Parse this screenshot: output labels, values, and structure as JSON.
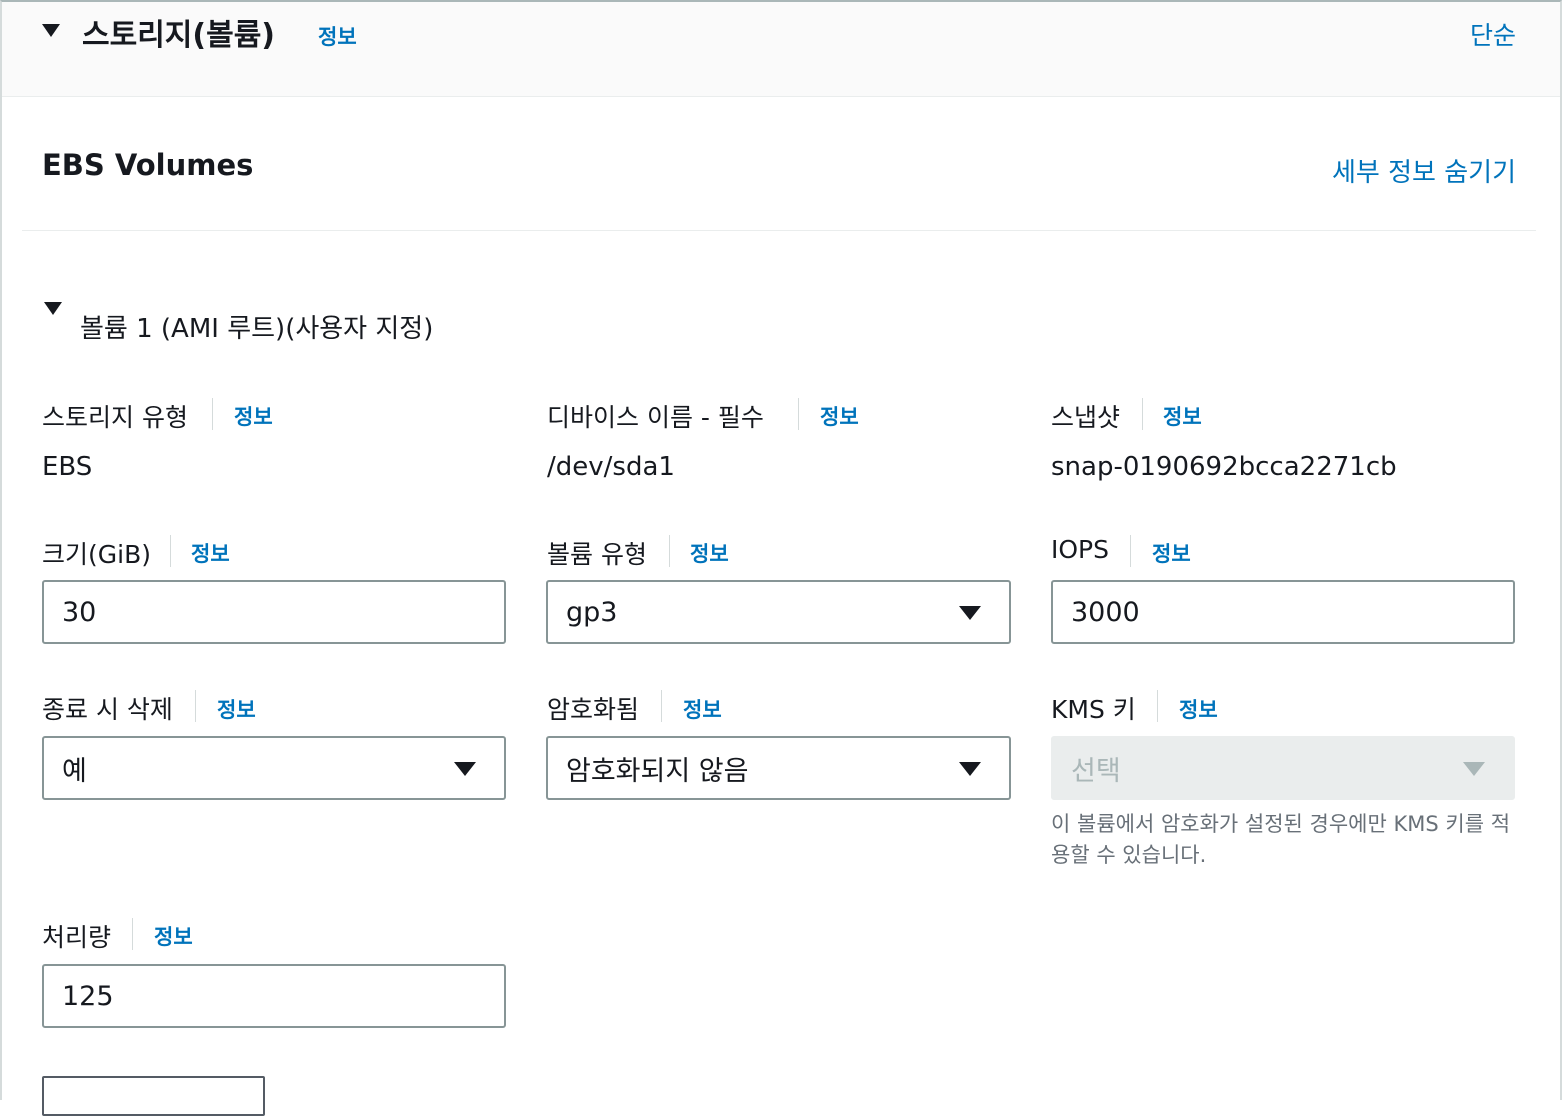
{
  "section": {
    "title": "스토리지(볼륨)",
    "info": "정보",
    "simple_link": "단순"
  },
  "ebs": {
    "title": "EBS Volumes",
    "hide_details": "세부 정보 숨기기"
  },
  "volume": {
    "title": "볼륨 1 (AMI 루트)(사용자 지정)",
    "storage_type": {
      "label": "스토리지 유형",
      "info": "정보",
      "value": "EBS"
    },
    "device_name": {
      "label": "디바이스 이름 - 필수",
      "info": "정보",
      "value": "/dev/sda1"
    },
    "snapshot": {
      "label": "스냅샷",
      "info": "정보",
      "value": "snap-0190692bcca2271cb"
    },
    "size": {
      "label": "크기(GiB)",
      "info": "정보",
      "value": "30"
    },
    "volume_type": {
      "label": "볼륨 유형",
      "info": "정보",
      "value": "gp3"
    },
    "iops": {
      "label": "IOPS",
      "info": "정보",
      "value": "3000"
    },
    "delete_on_termination": {
      "label": "종료 시 삭제",
      "info": "정보",
      "value": "예"
    },
    "encrypted": {
      "label": "암호화됨",
      "info": "정보",
      "value": "암호화되지 않음"
    },
    "kms_key": {
      "label": "KMS 키",
      "info": "정보",
      "placeholder": "선택",
      "hint": "이 볼륨에서 암호화가 설정된 경우에만 KMS 키를 적용할 수 있습니다."
    },
    "throughput": {
      "label": "처리량",
      "info": "정보",
      "value": "125"
    }
  },
  "icons": {
    "expand": "caret-down-icon",
    "select": "triangle-down-icon"
  }
}
